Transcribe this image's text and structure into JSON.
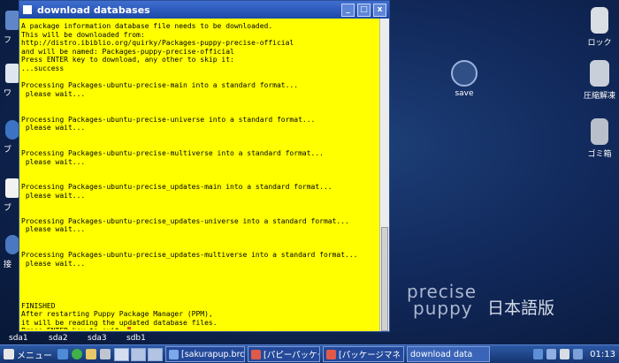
{
  "window": {
    "title": "download databases",
    "controls": {
      "minimize": "_",
      "maximize": "□",
      "close": "x"
    },
    "terminal_lines": [
      "A package information database file needs to be downloaded.",
      "This will be downloaded from:",
      "http://distro.ibiblio.org/quirky/Packages-puppy-precise-official",
      "and will be named: Packages-puppy-precise-official",
      "Press ENTER key to download, any other to skip it:",
      "...success",
      "",
      "Processing Packages-ubuntu-precise-main into a standard format...",
      " please wait...",
      "",
      "",
      "Processing Packages-ubuntu-precise-universe into a standard format...",
      " please wait...",
      "",
      "",
      "Processing Packages-ubuntu-precise-multiverse into a standard format...",
      " please wait...",
      "",
      "",
      "Processing Packages-ubuntu-precise_updates-main into a standard format...",
      " please wait...",
      "",
      "",
      "Processing Packages-ubuntu-precise_updates-universe into a standard format...",
      " please wait...",
      "",
      "",
      "Processing Packages-ubuntu-precise_updates-multiverse into a standard format...",
      " please wait...",
      "",
      "",
      "",
      "",
      "FINISHED",
      "After restarting Puppy Package Manager (PPM),",
      "it will be reading the updated database files.",
      "Press ENTER key to exit: "
    ]
  },
  "desktop": {
    "left_icon_labels": [
      "フ",
      "ワ",
      "ブ",
      "ブ",
      "接"
    ],
    "right_icons": [
      {
        "label": "ロック",
        "icon": "lock-icon"
      },
      {
        "label": "圧縮解凍",
        "icon": "archive-icon"
      },
      {
        "label": "ゴミ箱",
        "icon": "trash-icon"
      }
    ],
    "save_icon": {
      "label": "save",
      "icon": "save-disk-icon"
    },
    "drives": [
      "sda1",
      "sda2",
      "sda3",
      "sdb1"
    ],
    "brand": {
      "line1": "precise",
      "line2": "puppy",
      "line3": "日本語版"
    }
  },
  "taskbar": {
    "menu_label": "メニュー",
    "tasks": [
      {
        "label": "[sakurapup.brc"
      },
      {
        "label": "[パピーパッケー"
      },
      {
        "label": "[パッケージマネ"
      },
      {
        "label": "download data"
      }
    ],
    "clock": "01:13"
  }
}
